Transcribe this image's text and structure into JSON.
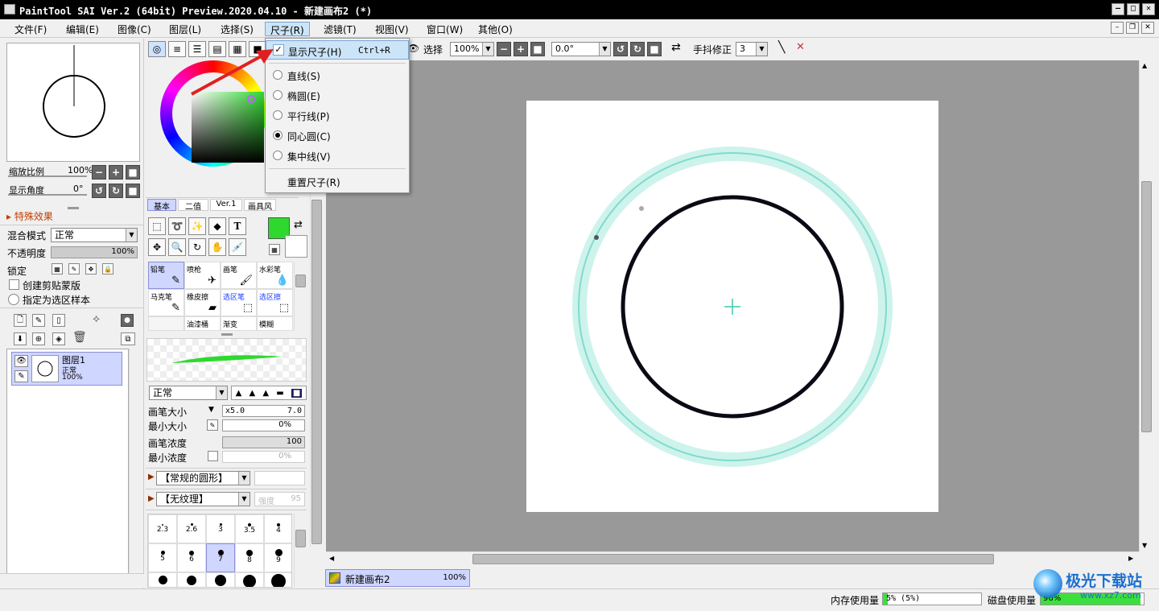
{
  "window": {
    "title": "PaintTool SAI Ver.2 (64bit) Preview.2020.04.10 - 新建画布2 (*)",
    "min": "–",
    "max": "□",
    "close": "✕"
  },
  "menu": [
    "文件(F)",
    "编辑(E)",
    "图像(C)",
    "图层(L)",
    "选择(S)",
    "尺子(R)",
    "滤镜(T)",
    "视图(V)",
    "窗口(W)",
    "其他(O)"
  ],
  "navigator": {
    "zoom_label": "缩放比例",
    "zoom_value": "100%",
    "angle_label": "显示角度",
    "angle_value": "0°"
  },
  "layer_panel": {
    "effects_label": "特殊效果",
    "blend_label": "混合模式",
    "blend_value": "正常",
    "opacity_label": "不透明度",
    "opacity_value": "100%",
    "lock_label": "锁定",
    "clip_label": "创建剪贴蒙版",
    "sample_label": "指定为选区样本",
    "layer_name": "图层1",
    "layer_mode": "正常",
    "layer_opacity": "100%"
  },
  "color_tabs": [
    "基本",
    "二值",
    "Ver.1",
    "画具风"
  ],
  "tools": {
    "brushes": [
      "铅笔",
      "喷枪",
      "画笔",
      "水彩笔",
      "马克笔",
      "橡皮擦",
      "选区笔",
      "选区擦",
      "",
      "油漆桶",
      "渐变",
      "模糊"
    ]
  },
  "brush_settings": {
    "mode": "正常",
    "size_label": "画笔大小",
    "size_mult": "x5.0",
    "size_value": "7.0",
    "min_size_label": "最小大小",
    "min_size_value": "0%",
    "density_label": "画笔浓度",
    "density_value": "100",
    "min_density_label": "最小浓度",
    "min_density_value": "0%",
    "shape": "【常规的圆形】",
    "texture": "【无纹理】",
    "texture_strength": "强度",
    "texture_value": "95"
  },
  "brush_sizes": [
    "2.3",
    "2.6",
    "3",
    "3.5",
    "4",
    "5",
    "6",
    "7",
    "8",
    "9",
    "",
    "",
    "",
    "",
    ""
  ],
  "toolbar": {
    "select_label": "选择",
    "zoom": "100%",
    "angle": "0.0°",
    "stabilizer_label": "手抖修正",
    "stabilizer_value": "3"
  },
  "ruler_menu": {
    "show": "显示尺子(H)",
    "shortcut": "Ctrl+R",
    "items": [
      "直线(S)",
      "椭圆(E)",
      "平行线(P)",
      "同心圆(C)",
      "集中线(V)"
    ],
    "selected": "同心圆(C)",
    "reset": "重置尺子(R)"
  },
  "doc_tab": {
    "name": "新建画布2",
    "zoom": "100%"
  },
  "status": {
    "mem_label": "内存使用量",
    "mem_value": "5% (5%)",
    "disk_label": "磁盘使用量",
    "disk_value": "96%"
  },
  "watermark": {
    "brand": "极光下载站",
    "url": "www.xz7.com"
  },
  "colors": {
    "primary": "#2fd82f",
    "ruler": "#9ee8dc"
  }
}
